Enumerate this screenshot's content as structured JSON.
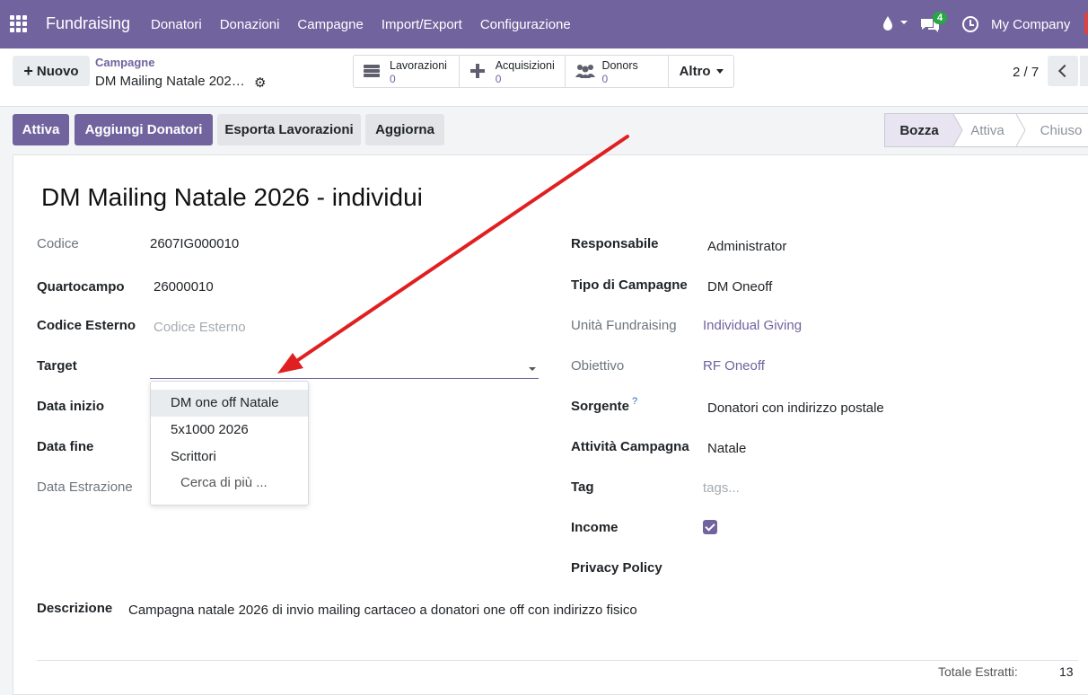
{
  "navbar": {
    "app_name": "Fundraising",
    "menu": [
      "Donatori",
      "Donazioni",
      "Campagne",
      "Import/Export",
      "Configurazione"
    ],
    "chat_badge": "4",
    "company": "My Company"
  },
  "control": {
    "new_label": "Nuovo",
    "breadcrumb_parent": "Campagne",
    "breadcrumb_current": "DM Mailing Natale 202…",
    "smart_buttons": [
      {
        "label": "Lavorazioni",
        "count": "0",
        "icon": "list-icon"
      },
      {
        "label": "Acquisizioni",
        "count": "0",
        "icon": "plus-icon"
      },
      {
        "label": "Donors",
        "count": "0",
        "icon": "users-icon"
      }
    ],
    "more_label": "Altro",
    "pager": "2 / 7"
  },
  "actions": {
    "attiva": "Attiva",
    "aggiungi": "Aggiungi Donatori",
    "esporta": "Esporta Lavorazioni",
    "aggiorna": "Aggiorna"
  },
  "stages": [
    "Bozza",
    "Attiva",
    "Chiuso"
  ],
  "current_stage": "Bozza",
  "form": {
    "title": "DM Mailing Natale 2026 -  individui",
    "left": {
      "codice_label": "Codice",
      "codice_value": "2607IG000010",
      "quartocampo_label": "Quartocampo",
      "quartocampo_value": "26000010",
      "codice_esterno_label": "Codice Esterno",
      "codice_esterno_placeholder": "Codice Esterno",
      "target_label": "Target",
      "data_inizio_label": "Data inizio",
      "data_fine_label": "Data fine",
      "data_estrazione_label": "Data Estrazione"
    },
    "right": {
      "responsabile_label": "Responsabile",
      "responsabile_value": "Administrator",
      "tipo_label": "Tipo di Campagne",
      "tipo_value": "DM Oneoff",
      "unita_label": "Unità Fundraising",
      "unita_value": "Individual Giving",
      "obiettivo_label": "Obiettivo",
      "obiettivo_value": "RF Oneoff",
      "sorgente_label": "Sorgente",
      "sorgente_help": "?",
      "sorgente_value": "Donatori con indirizzo postale",
      "attivita_label": "Attività Campagna",
      "attivita_value": "Natale",
      "tag_label": "Tag",
      "tag_placeholder": "tags...",
      "income_label": "Income",
      "income_checked": true,
      "privacy_label": "Privacy Policy"
    },
    "descrizione_label": "Descrizione",
    "descrizione_value": "Campagna natale 2026 di invio mailing cartaceo a donatori one off con indirizzo fisico",
    "totale_label": "Totale Estratti:",
    "totale_value": "13"
  },
  "dropdown": {
    "items": [
      "DM one off Natale",
      "5x1000 2026",
      "Scrittori"
    ],
    "more": "Cerca di più ..."
  },
  "colors": {
    "brand": "#71639e",
    "annotation_arrow": "#e02020"
  }
}
